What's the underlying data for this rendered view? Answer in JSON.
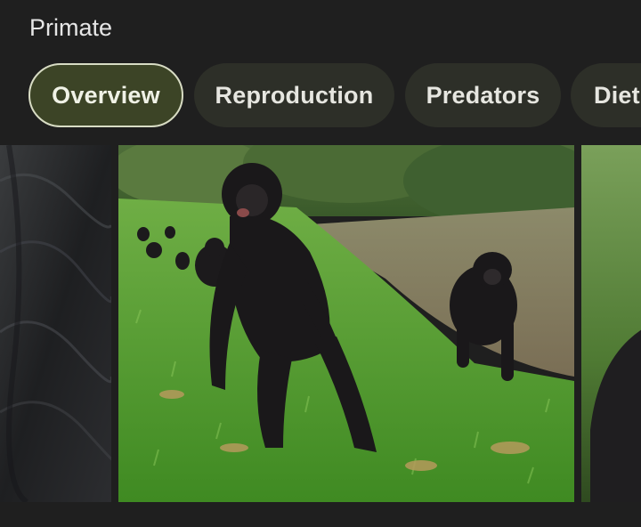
{
  "header": {
    "subtitle": "Primate"
  },
  "tabs": [
    {
      "label": "Overview",
      "selected": true
    },
    {
      "label": "Reproduction",
      "selected": false
    },
    {
      "label": "Predators",
      "selected": false
    },
    {
      "label": "Diet",
      "selected": false
    }
  ],
  "colors": {
    "background": "#1f1f1f",
    "chip": "#2d2f28",
    "chip_active": "#3c4426",
    "chip_active_border": "#d8dcc4"
  }
}
